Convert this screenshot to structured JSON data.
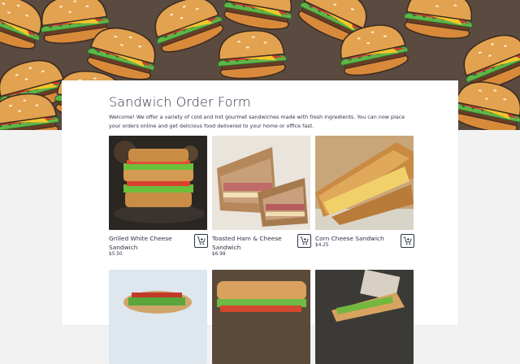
{
  "form": {
    "title": "Sandwich Order Form",
    "intro": "Welcome! We offer a variety of cold and hot gourmet sandwiches made with fresh ingredients. You can now place your orders online and get delicious food delivered to your home or office fast."
  },
  "products": [
    {
      "name": "Grilled White Cheese Sandwich",
      "price": "$5.50"
    },
    {
      "name": "Toasted Ham & Cheese Sandwich",
      "price": "$6.99"
    },
    {
      "name": "Corn Cheese Sandwich",
      "price": "$4.25"
    },
    {
      "name": "",
      "price": ""
    },
    {
      "name": "",
      "price": ""
    },
    {
      "name": "",
      "price": ""
    }
  ],
  "colors": {
    "text": "#2c3345",
    "hero_background": "#5b4a3f",
    "page_background": "#f2f2f2"
  },
  "icons": {
    "cart": "add-to-cart-icon"
  }
}
